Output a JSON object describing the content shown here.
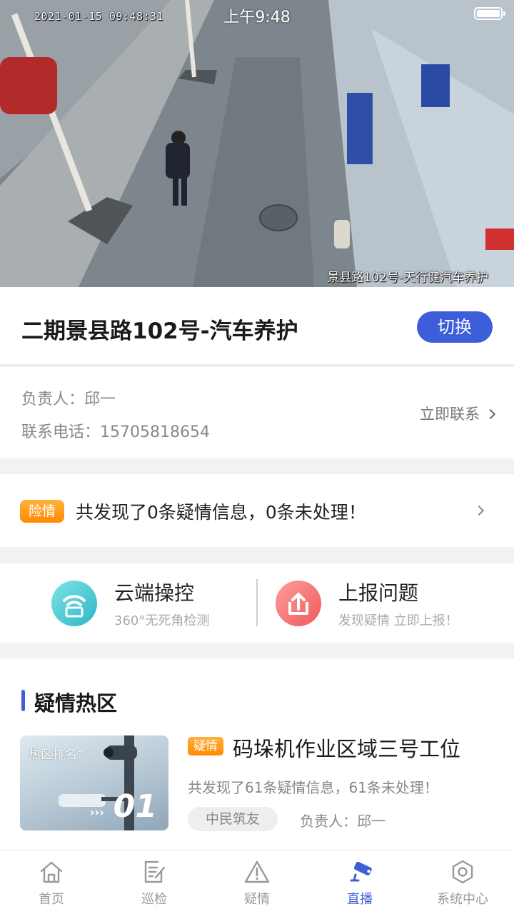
{
  "status_bar": {
    "time": "上午9:48"
  },
  "camera": {
    "timestamp": "2021-01-15 09:48:31",
    "location_label": "景县路102号-天行健汽车养护"
  },
  "site": {
    "title": "二期景县路102号-汽车养护",
    "switch_label": "切换"
  },
  "contact": {
    "owner": "负责人：邱一",
    "phone": "联系电话：15705818654",
    "contact_action": "立即联系"
  },
  "alert": {
    "badge": "险情",
    "text": "共发现了0条疑情信息，0条未处理！"
  },
  "actions": [
    {
      "title": "云端操控",
      "subtitle": "360°无死角检测"
    },
    {
      "title": "上报问题",
      "subtitle": "发现疑情 立即上报！"
    }
  ],
  "hotzone": {
    "section_title": "疑情热区",
    "items": [
      {
        "thumb_label": "热区排名：",
        "rank": "01",
        "tag": "疑情",
        "name": "码垛机作业区域三号工位",
        "desc": "共发现了61条疑情信息，61条未处理！",
        "chip": "中民筑友",
        "owner": "负责人：邱一"
      }
    ]
  },
  "tabbar": {
    "active_index": 3,
    "active_color": "#3e5ed9",
    "items": [
      {
        "label": "首页",
        "icon": "home-icon"
      },
      {
        "label": "巡检",
        "icon": "inspection-icon"
      },
      {
        "label": "疑情",
        "icon": "warning-icon"
      },
      {
        "label": "直播",
        "icon": "camera-icon"
      },
      {
        "label": "系统中心",
        "icon": "settings-icon"
      }
    ]
  }
}
